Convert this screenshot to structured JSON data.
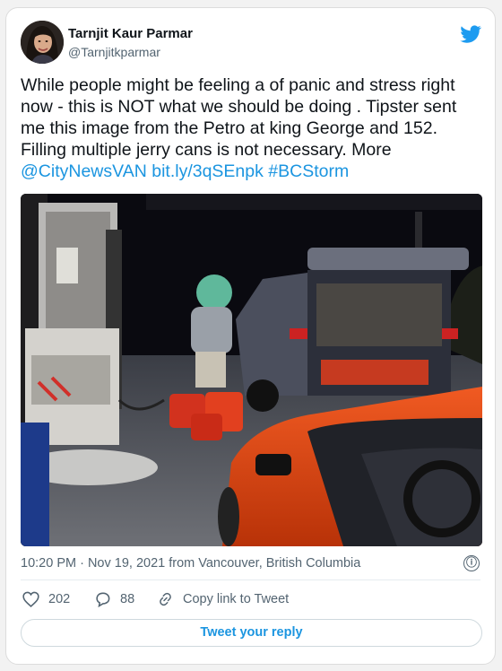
{
  "author": {
    "name": "Tarnjit Kaur Parmar",
    "handle": "@Tarnjitkparmar"
  },
  "tweet": {
    "text": "While people might be feeling a of panic and stress right now - this is NOT what we should be doing . Tipster sent me this image from the Petro at king George and 152. Filling multiple jerry cans is not necessary. More",
    "mention": "@CityNewsVAN",
    "link": "bit.ly/3qSEnpk",
    "hashtag": "#BCStorm"
  },
  "meta": {
    "timestamp": "10:20 PM · Nov 19, 2021 from Vancouver, British Columbia",
    "info_icon": "ⓘ"
  },
  "actions": {
    "likes": "202",
    "replies": "88",
    "copy_link": "Copy link to Tweet"
  },
  "reply_button": "Tweet your reply",
  "colors": {
    "link": "#1b95e0",
    "twitter_blue": "#1d9bf0",
    "text": "#0f1419",
    "muted": "#536471"
  },
  "icons": [
    "twitter-bird-icon",
    "heart-icon",
    "reply-bubble-icon",
    "link-icon",
    "info-icon"
  ]
}
